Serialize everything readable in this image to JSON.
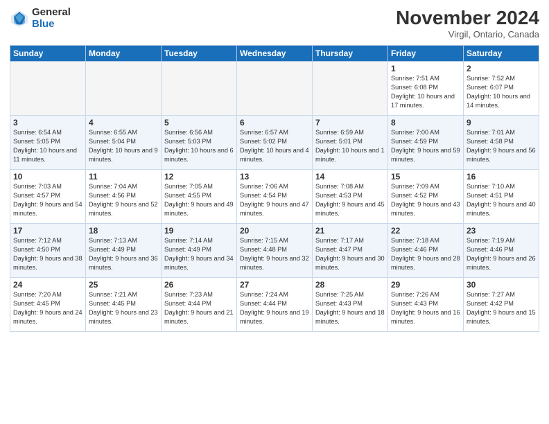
{
  "header": {
    "logo_general": "General",
    "logo_blue": "Blue",
    "month_title": "November 2024",
    "location": "Virgil, Ontario, Canada"
  },
  "weekdays": [
    "Sunday",
    "Monday",
    "Tuesday",
    "Wednesday",
    "Thursday",
    "Friday",
    "Saturday"
  ],
  "weeks": [
    [
      {
        "day": "",
        "info": ""
      },
      {
        "day": "",
        "info": ""
      },
      {
        "day": "",
        "info": ""
      },
      {
        "day": "",
        "info": ""
      },
      {
        "day": "",
        "info": ""
      },
      {
        "day": "1",
        "info": "Sunrise: 7:51 AM\nSunset: 6:08 PM\nDaylight: 10 hours and 17 minutes."
      },
      {
        "day": "2",
        "info": "Sunrise: 7:52 AM\nSunset: 6:07 PM\nDaylight: 10 hours and 14 minutes."
      }
    ],
    [
      {
        "day": "3",
        "info": "Sunrise: 6:54 AM\nSunset: 5:05 PM\nDaylight: 10 hours and 11 minutes."
      },
      {
        "day": "4",
        "info": "Sunrise: 6:55 AM\nSunset: 5:04 PM\nDaylight: 10 hours and 9 minutes."
      },
      {
        "day": "5",
        "info": "Sunrise: 6:56 AM\nSunset: 5:03 PM\nDaylight: 10 hours and 6 minutes."
      },
      {
        "day": "6",
        "info": "Sunrise: 6:57 AM\nSunset: 5:02 PM\nDaylight: 10 hours and 4 minutes."
      },
      {
        "day": "7",
        "info": "Sunrise: 6:59 AM\nSunset: 5:01 PM\nDaylight: 10 hours and 1 minute."
      },
      {
        "day": "8",
        "info": "Sunrise: 7:00 AM\nSunset: 4:59 PM\nDaylight: 9 hours and 59 minutes."
      },
      {
        "day": "9",
        "info": "Sunrise: 7:01 AM\nSunset: 4:58 PM\nDaylight: 9 hours and 56 minutes."
      }
    ],
    [
      {
        "day": "10",
        "info": "Sunrise: 7:03 AM\nSunset: 4:57 PM\nDaylight: 9 hours and 54 minutes."
      },
      {
        "day": "11",
        "info": "Sunrise: 7:04 AM\nSunset: 4:56 PM\nDaylight: 9 hours and 52 minutes."
      },
      {
        "day": "12",
        "info": "Sunrise: 7:05 AM\nSunset: 4:55 PM\nDaylight: 9 hours and 49 minutes."
      },
      {
        "day": "13",
        "info": "Sunrise: 7:06 AM\nSunset: 4:54 PM\nDaylight: 9 hours and 47 minutes."
      },
      {
        "day": "14",
        "info": "Sunrise: 7:08 AM\nSunset: 4:53 PM\nDaylight: 9 hours and 45 minutes."
      },
      {
        "day": "15",
        "info": "Sunrise: 7:09 AM\nSunset: 4:52 PM\nDaylight: 9 hours and 43 minutes."
      },
      {
        "day": "16",
        "info": "Sunrise: 7:10 AM\nSunset: 4:51 PM\nDaylight: 9 hours and 40 minutes."
      }
    ],
    [
      {
        "day": "17",
        "info": "Sunrise: 7:12 AM\nSunset: 4:50 PM\nDaylight: 9 hours and 38 minutes."
      },
      {
        "day": "18",
        "info": "Sunrise: 7:13 AM\nSunset: 4:49 PM\nDaylight: 9 hours and 36 minutes."
      },
      {
        "day": "19",
        "info": "Sunrise: 7:14 AM\nSunset: 4:49 PM\nDaylight: 9 hours and 34 minutes."
      },
      {
        "day": "20",
        "info": "Sunrise: 7:15 AM\nSunset: 4:48 PM\nDaylight: 9 hours and 32 minutes."
      },
      {
        "day": "21",
        "info": "Sunrise: 7:17 AM\nSunset: 4:47 PM\nDaylight: 9 hours and 30 minutes."
      },
      {
        "day": "22",
        "info": "Sunrise: 7:18 AM\nSunset: 4:46 PM\nDaylight: 9 hours and 28 minutes."
      },
      {
        "day": "23",
        "info": "Sunrise: 7:19 AM\nSunset: 4:46 PM\nDaylight: 9 hours and 26 minutes."
      }
    ],
    [
      {
        "day": "24",
        "info": "Sunrise: 7:20 AM\nSunset: 4:45 PM\nDaylight: 9 hours and 24 minutes."
      },
      {
        "day": "25",
        "info": "Sunrise: 7:21 AM\nSunset: 4:45 PM\nDaylight: 9 hours and 23 minutes."
      },
      {
        "day": "26",
        "info": "Sunrise: 7:23 AM\nSunset: 4:44 PM\nDaylight: 9 hours and 21 minutes."
      },
      {
        "day": "27",
        "info": "Sunrise: 7:24 AM\nSunset: 4:44 PM\nDaylight: 9 hours and 19 minutes."
      },
      {
        "day": "28",
        "info": "Sunrise: 7:25 AM\nSunset: 4:43 PM\nDaylight: 9 hours and 18 minutes."
      },
      {
        "day": "29",
        "info": "Sunrise: 7:26 AM\nSunset: 4:43 PM\nDaylight: 9 hours and 16 minutes."
      },
      {
        "day": "30",
        "info": "Sunrise: 7:27 AM\nSunset: 4:42 PM\nDaylight: 9 hours and 15 minutes."
      }
    ]
  ]
}
